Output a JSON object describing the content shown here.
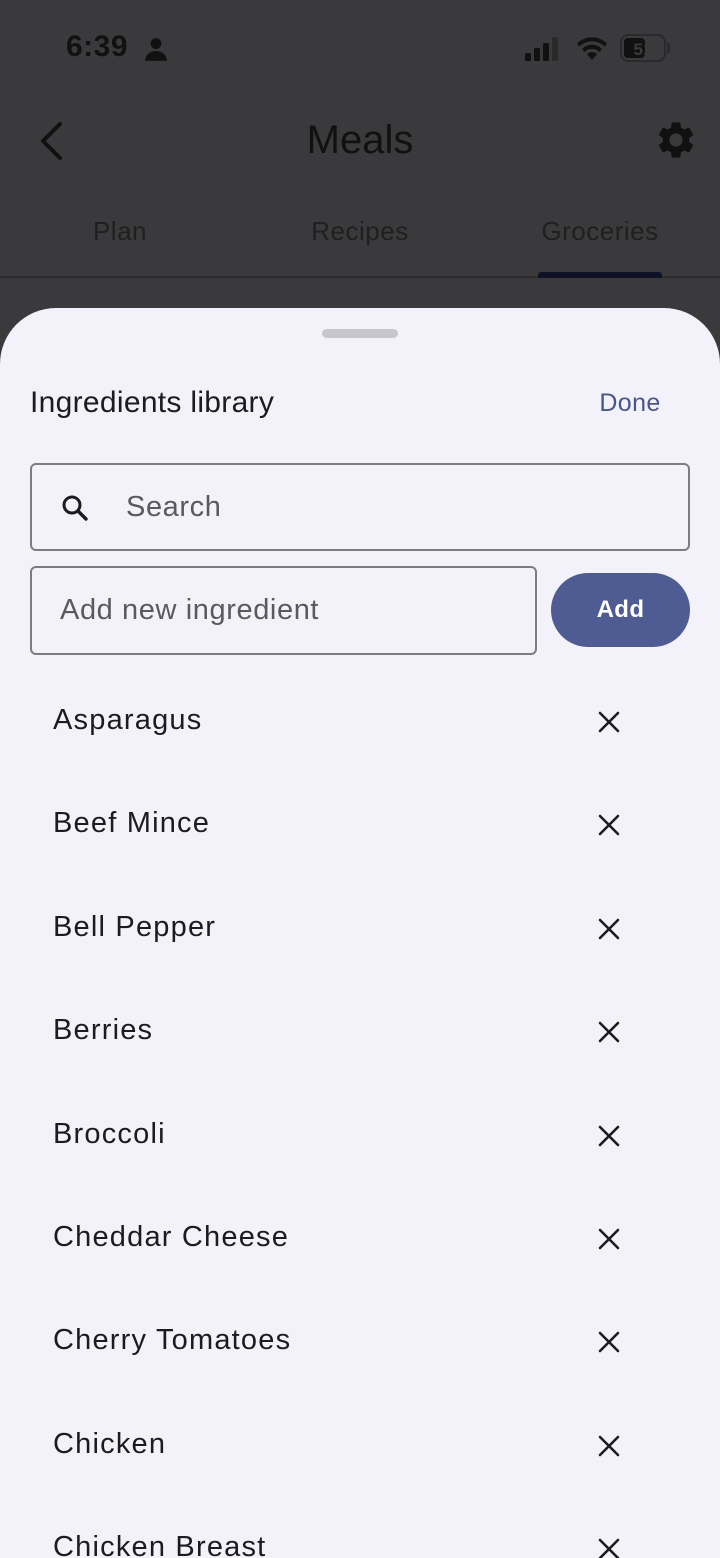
{
  "status_bar": {
    "time": "6:39",
    "battery": "51"
  },
  "header": {
    "title": "Meals"
  },
  "tabs": [
    {
      "label": "Plan"
    },
    {
      "label": "Recipes"
    },
    {
      "label": "Groceries",
      "selected": true
    }
  ],
  "sheet": {
    "title": "Ingredients library",
    "done_label": "Done",
    "search": {
      "placeholder": "Search",
      "value": ""
    },
    "add_field": {
      "placeholder": "Add new ingredient",
      "value": ""
    },
    "add_label": "Add",
    "ingredients": [
      {
        "name": "Asparagus"
      },
      {
        "name": "Beef Mince"
      },
      {
        "name": "Bell Pepper"
      },
      {
        "name": "Berries"
      },
      {
        "name": "Broccoli"
      },
      {
        "name": "Cheddar Cheese"
      },
      {
        "name": "Cherry Tomatoes"
      },
      {
        "name": "Chicken"
      },
      {
        "name": "Chicken Breast"
      }
    ]
  },
  "colors": {
    "accent": "#4f5b93",
    "done_text": "#4a5688",
    "sheet_background": "#f3f1fa",
    "scrim": "#3a3a3c"
  },
  "icons": {
    "status": [
      "person-icon",
      "signal-icon",
      "wifi-icon",
      "battery-icon"
    ],
    "header": [
      "back-icon",
      "gear-icon"
    ],
    "search": "search-icon",
    "remove": "close-icon"
  }
}
